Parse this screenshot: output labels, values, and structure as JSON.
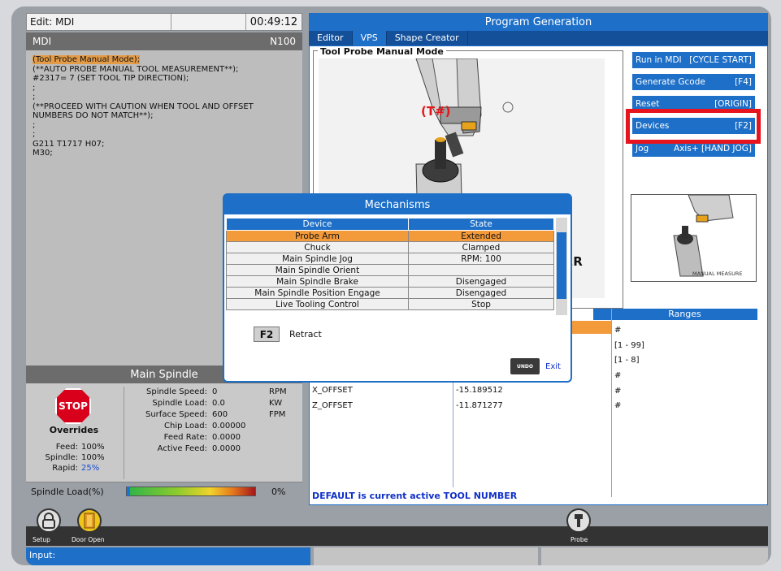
{
  "edit_bar": {
    "title": "Edit: MDI",
    "time": "00:49:12"
  },
  "mdi": {
    "title": "MDI",
    "block": "N100",
    "code": [
      "(Tool Probe Manual Mode);",
      "(**AUTO PROBE MANUAL TOOL MEASUREMENT**);",
      "#2317= 7 (SET TOOL TIP DIRECTION);",
      ";",
      ";",
      "(**PROCEED WITH CAUTION WHEN TOOL AND OFFSET",
      "NUMBERS DO NOT MATCH**);",
      ";",
      ";",
      "G211 T1717 H07;",
      "M30;"
    ]
  },
  "main_spindle": {
    "title": "Main Spindle",
    "stop_label": "STOP",
    "overrides_label": "Overrides",
    "overrides": [
      {
        "label": "Feed:",
        "value": "100%"
      },
      {
        "label": "Spindle:",
        "value": "100%"
      },
      {
        "label": "Rapid:",
        "value": "25%",
        "color": "#1a4fd6"
      }
    ],
    "stats": [
      {
        "label": "Spindle Speed:",
        "value": "0",
        "unit": "RPM"
      },
      {
        "label": "Spindle Load:",
        "value": "0.0",
        "unit": "KW"
      },
      {
        "label": "Surface Speed:",
        "value": "600",
        "unit": "FPM"
      },
      {
        "label": "Chip Load:",
        "value": "0.00000",
        "unit": ""
      },
      {
        "label": "Feed Rate:",
        "value": "0.0000",
        "unit": ""
      },
      {
        "label": "Active Feed:",
        "value": "0.0000",
        "unit": ""
      }
    ],
    "load_label": "Spindle Load(%)",
    "load_value": "0%",
    "load_fraction": 0.0
  },
  "program_generation": {
    "title": "Program Generation",
    "tabs": [
      "Editor",
      "VPS",
      "Shape Creator"
    ],
    "active_tab": "VPS",
    "section_label": "Tool Probe Manual Mode",
    "tool_callout": "(T#)",
    "partial_text": "ER",
    "thumbnail_caption": "MANUAL MEASURE",
    "side_buttons": [
      {
        "label": "Run in MDI",
        "key": "[CYCLE START]"
      },
      {
        "label": "Generate Gcode",
        "key": "[F4]"
      },
      {
        "label": "Reset",
        "key": "[ORIGIN]"
      },
      {
        "label": "Devices",
        "key": "[F2]"
      },
      {
        "label": "Jog",
        "key": "Axis+ [HAND JOG]"
      }
    ],
    "ranges_header": "Ranges",
    "ranges": [
      "#",
      "[1 - 99]",
      "[1 - 8]",
      "#",
      "#",
      "#"
    ],
    "offsets": [
      {
        "name": "X_OFFSET",
        "value": "-15.189512"
      },
      {
        "name": "Z_OFFSET",
        "value": "-11.871277"
      }
    ],
    "default_msg": "DEFAULT is current active TOOL NUMBER"
  },
  "mechanisms": {
    "title": "Mechanisms",
    "headers": [
      "Device",
      "State"
    ],
    "rows": [
      {
        "device": "Probe Arm",
        "state": "Extended",
        "selected": true
      },
      {
        "device": "Chuck",
        "state": "Clamped"
      },
      {
        "device": "Main Spindle Jog",
        "state": "RPM: 100"
      },
      {
        "device": "Main Spindle Orient",
        "state": ""
      },
      {
        "device": "Main Spindle Brake",
        "state": "Disengaged"
      },
      {
        "device": "Main Spindle Position Engage",
        "state": "Disengaged"
      },
      {
        "device": "Live Tooling Control",
        "state": "Stop"
      }
    ],
    "f2_key": "F2",
    "f2_action": "Retract",
    "undo_key": "UNDO",
    "exit_label": "Exit"
  },
  "bottom": {
    "setup_label": "Setup",
    "door_label": "Door Open",
    "probe_label": "Probe",
    "input_label": "Input:"
  },
  "colors": {
    "accent": "#1d6fc8",
    "highlight": "#f39a3b",
    "alert": "#e8141d"
  }
}
